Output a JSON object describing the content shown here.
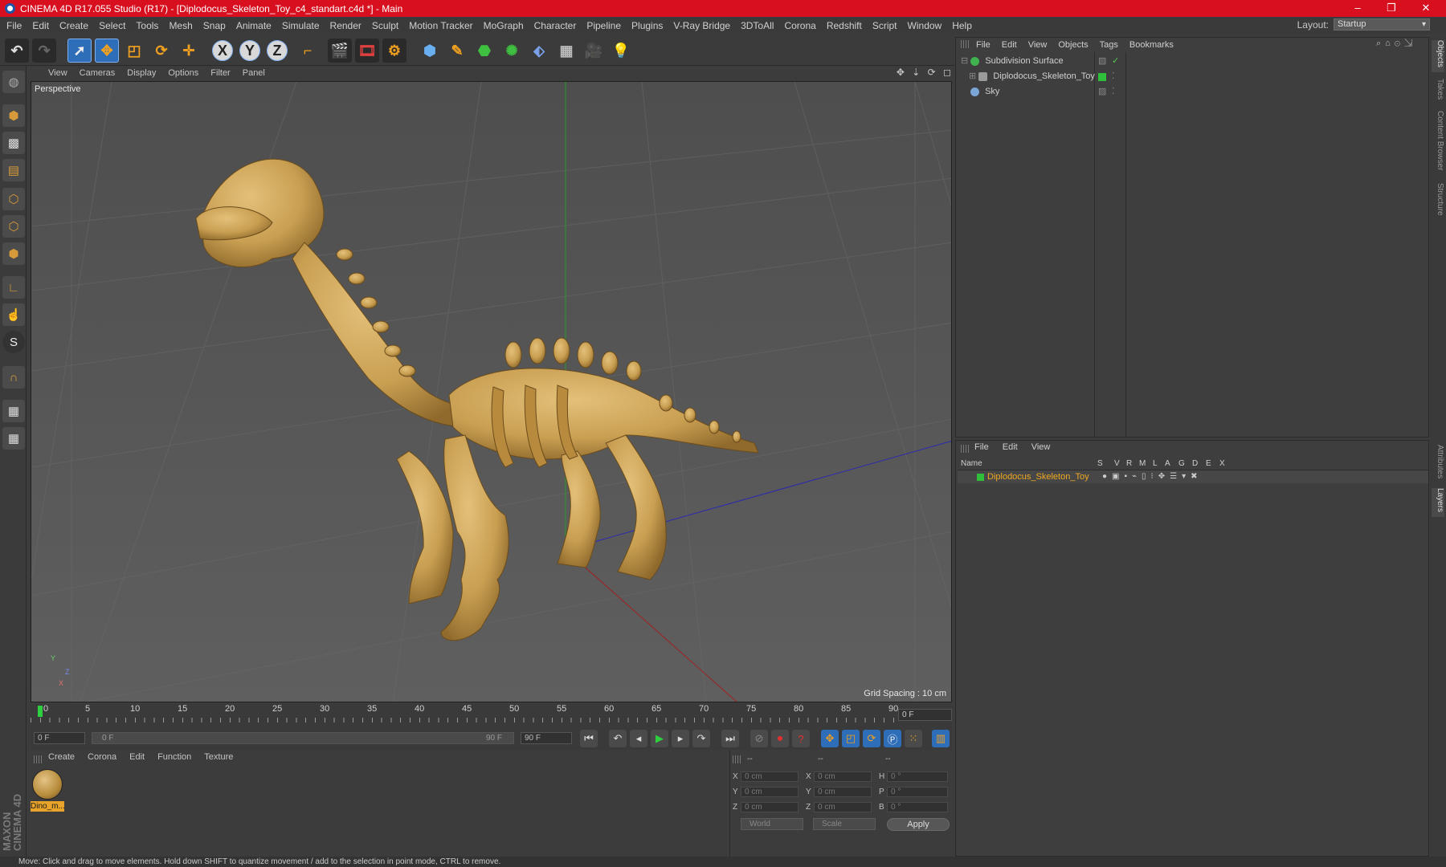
{
  "titlebar": {
    "title": "CINEMA 4D R17.055 Studio (R17) - [Diplodocus_Skeleton_Toy_c4_standart.c4d *] - Main",
    "minimize": "–",
    "maximize": "❐",
    "close": "✕"
  },
  "menubar": {
    "items": [
      "File",
      "Edit",
      "Create",
      "Select",
      "Tools",
      "Mesh",
      "Snap",
      "Animate",
      "Simulate",
      "Render",
      "Sculpt",
      "Motion Tracker",
      "MoGraph",
      "Character",
      "Pipeline",
      "Plugins",
      "V-Ray Bridge",
      "3DToAll",
      "Corona",
      "Redshift",
      "Script",
      "Window",
      "Help"
    ]
  },
  "layout": {
    "label": "Layout:",
    "value": "Startup"
  },
  "toolbar": {
    "x_label": "X",
    "y_label": "Y",
    "z_label": "Z"
  },
  "viewport": {
    "menu": [
      "View",
      "Cameras",
      "Display",
      "Options",
      "Filter",
      "Panel"
    ],
    "nav_icons": "✥ ⇣ ⟳ ◻",
    "label": "Perspective",
    "grid_spacing": "Grid Spacing : 10 cm",
    "axis": {
      "y": "Y",
      "z": "Z",
      "x": "X"
    }
  },
  "timeline": {
    "ticks": [
      "0",
      "5",
      "10",
      "15",
      "20",
      "25",
      "30",
      "35",
      "40",
      "45",
      "50",
      "55",
      "60",
      "65",
      "70",
      "75",
      "80",
      "85",
      "90"
    ],
    "current_frame": "0 F",
    "start_field": "0 F",
    "range_start": "0 F",
    "range_end": "90 F",
    "end_field": "90 F"
  },
  "materials": {
    "menu": [
      "Create",
      "Corona",
      "Edit",
      "Function",
      "Texture"
    ],
    "items": [
      {
        "name": "Dino_m..."
      }
    ]
  },
  "coordinates": {
    "headers": [
      "--",
      "--",
      "--"
    ],
    "rows": [
      {
        "l1": "X",
        "v1": "0 cm",
        "l2": "X",
        "v2": "0 cm",
        "l3": "H",
        "v3": "0 °"
      },
      {
        "l1": "Y",
        "v1": "0 cm",
        "l2": "Y",
        "v2": "0 cm",
        "l3": "P",
        "v3": "0 °"
      },
      {
        "l1": "Z",
        "v1": "0 cm",
        "l2": "Z",
        "v2": "0 cm",
        "l3": "B",
        "v3": "0 °"
      }
    ],
    "space": "World",
    "mode": "Scale",
    "apply": "Apply"
  },
  "status": "Move: Click and drag to move elements. Hold down SHIFT to quantize movement / add to the selection in point mode, CTRL to remove.",
  "object_manager": {
    "menu": [
      "File",
      "Edit",
      "View",
      "Objects",
      "Tags",
      "Bookmarks"
    ],
    "objects": [
      {
        "name": "Subdivision Surface",
        "color": "#3fb34f"
      },
      {
        "name": "Diplodocus_Skeleton_Toy",
        "color": "#9a9a9a"
      },
      {
        "name": "Sky",
        "color": "#7aa7d8"
      }
    ]
  },
  "layer_manager": {
    "menu": [
      "File",
      "Edit",
      "View"
    ],
    "columns": [
      "Name",
      "S",
      "V",
      "R",
      "M",
      "L",
      "A",
      "G",
      "D",
      "E",
      "X"
    ],
    "layers": [
      {
        "name": "Diplodocus_Skeleton_Toy",
        "color": "#2fbf3a"
      }
    ]
  },
  "right_tabs": [
    "Objects",
    "Takes",
    "Content Browser",
    "Structure",
    "Attributes",
    "Layers"
  ],
  "logo": {
    "text": "MAXON CINEMA 4D"
  },
  "colors": {
    "accent": "#2e6db8",
    "title_red": "#d70f1f",
    "model": "#c99f52"
  }
}
